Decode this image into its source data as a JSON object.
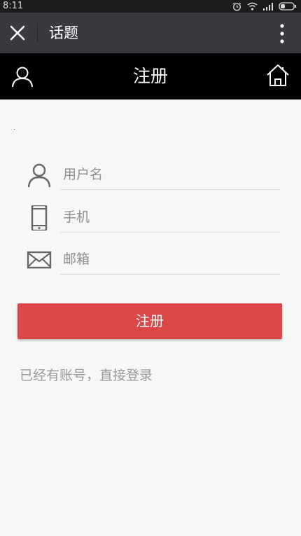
{
  "status_bar": {
    "time": "8:11",
    "icons": [
      "alarm-icon",
      "wifi-icon",
      "signal-icon",
      "battery-icon"
    ]
  },
  "wechat_bar": {
    "title": "话题",
    "close_icon": "close-icon",
    "more_icon": "more-vertical-icon"
  },
  "header": {
    "title": "注册",
    "left_icon": "user-icon",
    "right_icon": "home-icon"
  },
  "form": {
    "username": {
      "placeholder": "用户名",
      "value": "",
      "icon": "user-icon"
    },
    "phone": {
      "placeholder": "手机",
      "value": "",
      "icon": "phone-icon"
    },
    "email": {
      "placeholder": "邮箱",
      "value": "",
      "icon": "mail-icon"
    },
    "submit_label": "注册"
  },
  "login_link": "已经有账号，直接登录",
  "colors": {
    "status_bar": "#1c1c1c",
    "wechat_bar": "#393a3f",
    "header": "#000000",
    "background": "#f7f7f7",
    "button": "#dc4748",
    "link": "#9a9a9a"
  }
}
